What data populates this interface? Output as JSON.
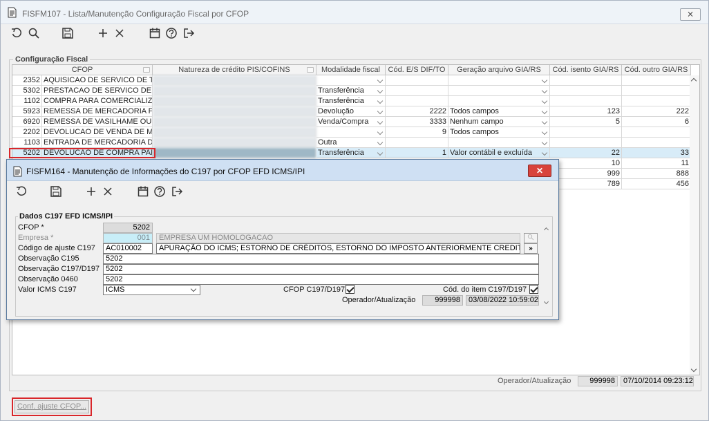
{
  "window": {
    "title": "FISFM107 - Lista/Manutenção Configuração Fiscal por CFOP",
    "close": "⨯"
  },
  "group": {
    "label": "Configuração Fiscal"
  },
  "grid": {
    "columns": [
      "CFOP",
      "Natureza de crédito PIS/COFINS",
      "Modalidade fiscal",
      "Cód. E/S DIF/TO",
      "Geração arquivo GIA/RS",
      "Cód. isento GIA/RS",
      "Cód. outro GIA/RS"
    ],
    "rows": [
      {
        "code": "2352",
        "desc": "AQUISICAO DE SERVICO DE TRA",
        "mod": "",
        "es": "",
        "gia": "",
        "isento": "",
        "outro": ""
      },
      {
        "code": "5302",
        "desc": "PRESTACAO DE SERVICO DE CC",
        "mod": "Transferência",
        "es": "",
        "gia": "",
        "isento": "",
        "outro": ""
      },
      {
        "code": "1102",
        "desc": "COMPRA PARA COMERCIALIZAC",
        "mod": "Transferência",
        "es": "",
        "gia": "",
        "isento": "",
        "outro": ""
      },
      {
        "code": "5923",
        "desc": "REMESSA DE MERCADORIA POR",
        "mod": "Devolução",
        "es": "2222",
        "gia": "Todos campos",
        "isento": "123",
        "outro": "222"
      },
      {
        "code": "6920",
        "desc": "REMESSA DE VASILHAME OU S/",
        "mod": "Venda/Compra",
        "es": "3333",
        "gia": "Nenhum campo",
        "isento": "5",
        "outro": "6"
      },
      {
        "code": "2202",
        "desc": "DEVOLUCAO DE VENDA DE MEF",
        "mod": "",
        "es": "9",
        "gia": "Todos campos",
        "isento": "",
        "outro": ""
      },
      {
        "code": "1103",
        "desc": "ENTRADA DE MERCADORIA DE T",
        "mod": "Outra",
        "es": "",
        "gia": "",
        "isento": "",
        "outro": ""
      },
      {
        "code": "5202",
        "desc": "DEVOLUCAO DE COMPRA PARA",
        "mod": "Transferência",
        "es": "1",
        "gia": "Valor contábil e excluída",
        "isento": "22",
        "outro": "33"
      },
      {
        "code": "",
        "desc": "",
        "mod": "",
        "es": "",
        "gia": "",
        "isento": "10",
        "outro": "11"
      },
      {
        "code": "",
        "desc": "",
        "mod": "",
        "es": "",
        "gia": "",
        "isento": "999",
        "outro": "888"
      },
      {
        "code": "",
        "desc": "",
        "mod": "",
        "es": "",
        "gia": "",
        "isento": "789",
        "outro": "456"
      }
    ]
  },
  "footer": {
    "label": "Operador/Atualização",
    "operator": "999998",
    "datetime": "07/10/2014 09:23:12",
    "conf_button": "Conf. ajuste CFOP..."
  },
  "dialog": {
    "title": "FISFM164 - Manutenção de Informações do C197 por CFOP EFD ICMS/IPI",
    "close": "✕",
    "group_label": "Dados C197 EFD ICMS/IPI",
    "cfop_label": "CFOP *",
    "cfop_value": "5202",
    "empresa_label": "Empresa *",
    "empresa_code": "001",
    "empresa_name": "EMPRESA UM HOMOLOGACAO",
    "ajuste_label": "Código de ajuste C197",
    "ajuste_code": "AC010002",
    "ajuste_desc": "APURAÇÃO DO ICMS; ESTORNO DE CRÉDITOS, ESTORNO DO IMPOSTO ANTERIORMENTE CREDITADO QUA",
    "ajuste_btn": "»",
    "obs195_label": "Observação C195",
    "obs195_value": "5202",
    "obs197_label": "Observação C197/D197",
    "obs197_value": "5202",
    "obs460_label": "Observação 0460",
    "obs460_value": "5202",
    "valor_label": "Valor ICMS C197",
    "valor_value": "ICMS",
    "cfop_c197_label": "CFOP C197/D197",
    "cod_item_label": "Cód. do item C197/D197",
    "oper_label": "Operador/Atualização",
    "oper_value": "999998",
    "oper_datetime": "03/08/2022 10:59:02"
  }
}
